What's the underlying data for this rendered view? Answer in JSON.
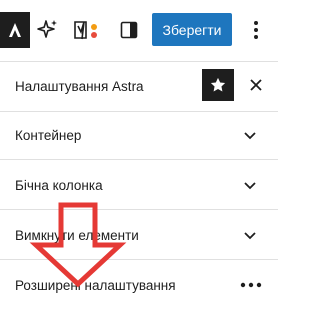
{
  "toolbar": {
    "save_label": "Зберегти"
  },
  "panel": {
    "title": "Налаштування Astra"
  },
  "sections": [
    {
      "label": "Контейнер"
    },
    {
      "label": "Бічна колонка"
    },
    {
      "label": "Вимкнути елементи"
    },
    {
      "label": "Розширені налаштування"
    }
  ],
  "colors": {
    "accent": "#1e76be",
    "dark": "#1e1e1e",
    "annotation": "#e53935"
  }
}
